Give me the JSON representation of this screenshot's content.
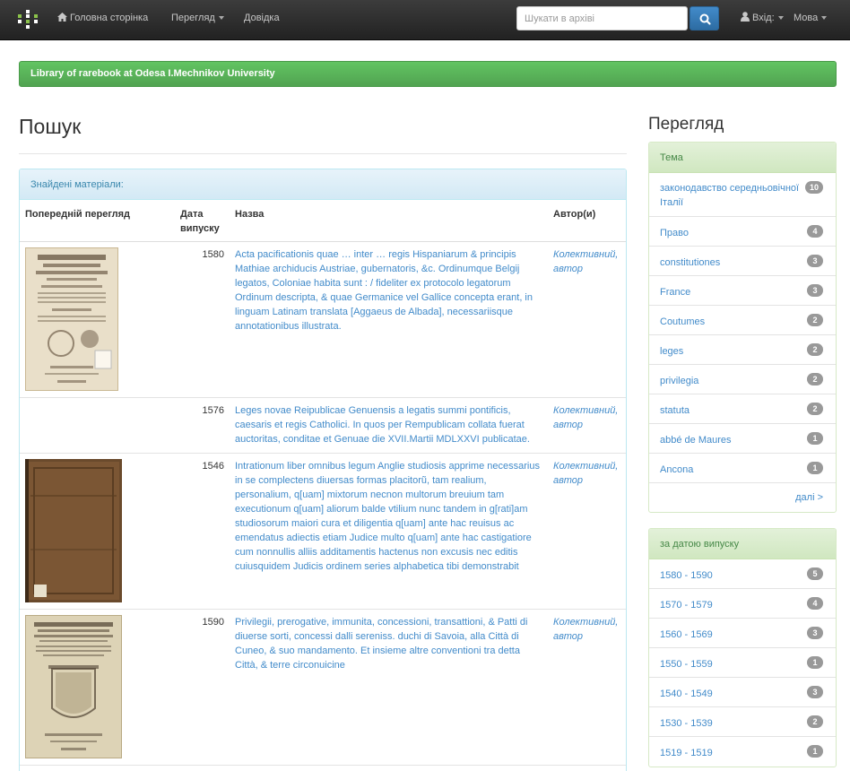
{
  "nav": {
    "home": "Головна сторінка",
    "browse": "Перегляд",
    "help": "Довідка",
    "search_placeholder": "Шукати в архіві",
    "login": "Вхід:",
    "language": "Мова"
  },
  "banner": "Library of rarebook at Odesa I.Mechnikov University",
  "page_title": "Пошук",
  "results": {
    "heading": "Знайдені матеріали:",
    "columns": [
      "Попередній перегляд",
      "Дата випуску",
      "Назва",
      "Автор(и)"
    ],
    "rows": [
      {
        "date": "1580",
        "title": "Acta pacificationis quae … inter … regis Hispaniarum & principis Mathiae archiducis Austriae, gubernatoris, &c. Ordinumque Belgij legatos, Coloniae habita sunt : / fideliter ex protocolo legatorum Ordinum descripta, & quae Germanice vel Gallice concepta erant, in linguam Latinam translata [Aggaeus de Albada], necessariisque annotationibus illustrata.",
        "author": "Колективний, автор"
      },
      {
        "date": "1576",
        "title": "Leges novae Reipublicae Genuensis a legatis summi pontificis, caesaris et regis Catholici. In quos per Rempublicam collata fuerat auctoritas, conditae et Genuae die XVII.Martii MDLXXVI publicatae.",
        "author": "Колективний, автор"
      },
      {
        "date": "1546",
        "title": "Intrationum liber omnibus legum Anglie studiosis apprime necessarius in se complectens diuersas formas placitorũ, tam realium, personalium, q[uam] mixtorum necnon multorum breuium tam executionum q[uam] aliorum balde vtilium nunc tandem in g[rati]am studiosorum maiori cura et diligentia q[uam] ante hac reuisus ac emendatus adiectis etiam Judice multo q[uam] ante hac castigatiore cum nonnullis alliis additamentis hactenus non excusis nec editis cuiusquidem Judicis ordinem series alphabetica tibi demonstrabit",
        "author": "Колективний, автор"
      },
      {
        "date": "1590",
        "title": "Privilegii, prerogative, immunita, concessioni, transattioni, & Patti di diuerse sorti, concessi dalli sereniss. duchi di Savoia, alla Città di Cuneo, & suo mandamento. Et insieme altre conventioni tra detta Città, & terre circonuicine",
        "author": "Колективний, автор"
      }
    ]
  },
  "sidebar": {
    "title": "Перегляд",
    "subject": {
      "heading": "Тема",
      "items": [
        {
          "label": "законодавство середньовічної Італії",
          "count": "10"
        },
        {
          "label": "Право",
          "count": "4"
        },
        {
          "label": "constitutiones",
          "count": "3"
        },
        {
          "label": "France",
          "count": "3"
        },
        {
          "label": "Coutumes",
          "count": "2"
        },
        {
          "label": "leges",
          "count": "2"
        },
        {
          "label": "privilegia",
          "count": "2"
        },
        {
          "label": "statuta",
          "count": "2"
        },
        {
          "label": "abbé de Maures",
          "count": "1"
        },
        {
          "label": "Ancona",
          "count": "1"
        }
      ],
      "more": "далі >"
    },
    "date": {
      "heading": "за датою випуску",
      "items": [
        {
          "label": "1580 - 1590",
          "count": "5"
        },
        {
          "label": "1570 - 1579",
          "count": "4"
        },
        {
          "label": "1560 - 1569",
          "count": "3"
        },
        {
          "label": "1550 - 1559",
          "count": "1"
        },
        {
          "label": "1540 - 1549",
          "count": "3"
        },
        {
          "label": "1530 - 1539",
          "count": "2"
        },
        {
          "label": "1519 - 1519",
          "count": "1"
        }
      ]
    }
  }
}
